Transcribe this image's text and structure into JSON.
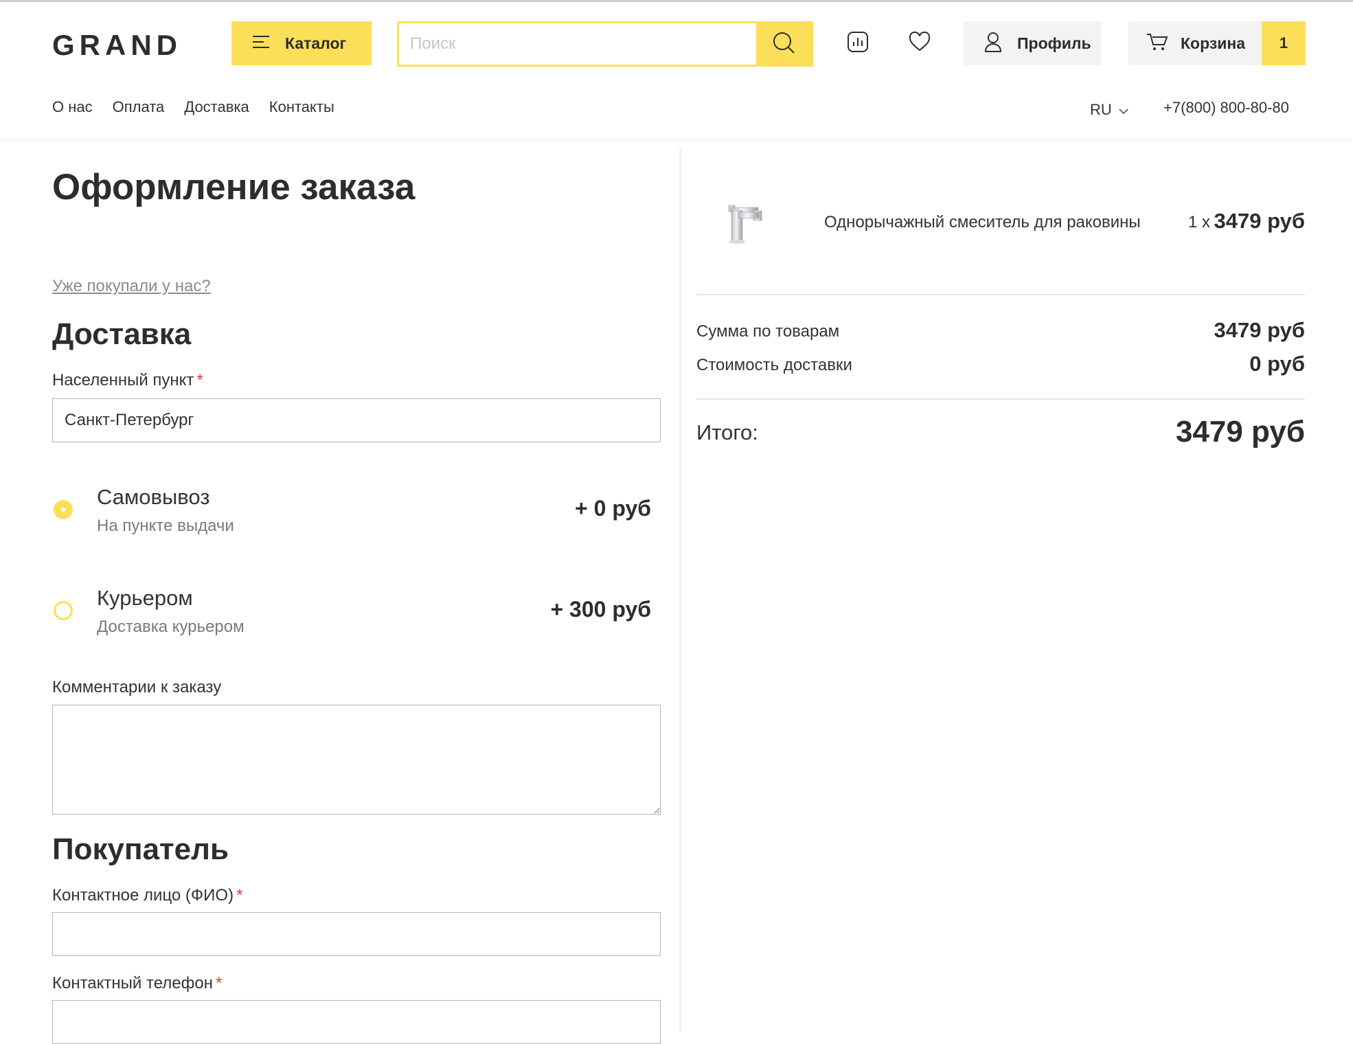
{
  "header": {
    "logo": "GRAND",
    "catalog_label": "Каталог",
    "search_placeholder": "Поиск",
    "search_value": "",
    "profile_label": "Профиль",
    "cart_label": "Корзина",
    "cart_count": "1",
    "nav": [
      "О нас",
      "Оплата",
      "Доставка",
      "Контакты"
    ],
    "lang": "RU",
    "phone": "+7(800) 800-80-80",
    "accent_color": "#fbdf58"
  },
  "checkout": {
    "title": "Оформление заказа",
    "already_bought_link": "Уже покупали у нас?",
    "delivery": {
      "heading": "Доставка",
      "city_label": "Населенный пункт",
      "required_mark": "*",
      "city_value": "Санкт-Петербург",
      "options": [
        {
          "title": "Самовывоз",
          "subtitle": "На пункте выдачи",
          "price": "+ 0 руб",
          "selected": true
        },
        {
          "title": "Курьером",
          "subtitle": "Доставка курьером",
          "price": "+ 300 руб",
          "selected": false
        }
      ],
      "comments_label": "Комментарии к заказу",
      "comments_value": ""
    },
    "buyer": {
      "heading": "Покупатель",
      "name_label": "Контактное лицо (ФИО)",
      "name_value": "",
      "phone_label": "Контактный телефон",
      "phone_value": ""
    }
  },
  "summary": {
    "item": {
      "name": "Однорычажный смеситель для раковины",
      "qty": "1 x",
      "price": "3479 руб"
    },
    "goods_sum_label": "Сумма по товарам",
    "goods_sum_value": "3479 руб",
    "delivery_cost_label": "Стоимость доставки",
    "delivery_cost_value": "0 руб",
    "total_label": "Итого:",
    "total_value": "3479 руб"
  }
}
